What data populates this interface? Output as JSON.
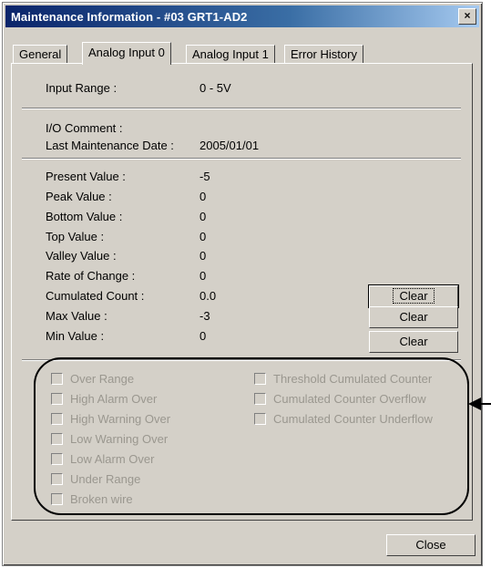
{
  "window": {
    "title": "Maintenance Information - #03 GRT1-AD2",
    "close_glyph": "×"
  },
  "tabs": [
    {
      "label": "General",
      "active": false
    },
    {
      "label": "Analog Input 0",
      "active": true
    },
    {
      "label": "Analog Input 1",
      "active": false
    },
    {
      "label": "Error History",
      "active": false
    }
  ],
  "fields": {
    "input_range": {
      "label": "Input Range :",
      "value": "0 - 5V"
    },
    "io_comment": {
      "label": "I/O Comment :",
      "value": ""
    },
    "last_maintenance_date": {
      "label": "Last Maintenance Date :",
      "value": "2005/01/01"
    },
    "present_value": {
      "label": "Present Value :",
      "value": "-5"
    },
    "peak_value": {
      "label": "Peak Value :",
      "value": "0"
    },
    "bottom_value": {
      "label": "Bottom Value :",
      "value": "0"
    },
    "top_value": {
      "label": "Top Value :",
      "value": "0"
    },
    "valley_value": {
      "label": "Valley Value :",
      "value": "0"
    },
    "rate_of_change": {
      "label": "Rate of Change :",
      "value": "0"
    },
    "cumulated_count": {
      "label": "Cumulated Count :",
      "value": "0.0"
    },
    "max_value": {
      "label": "Max Value :",
      "value": "-3"
    },
    "min_value": {
      "label": "Min Value :",
      "value": "0"
    }
  },
  "buttons": {
    "clear_cumulated": "Clear",
    "clear_max": "Clear",
    "clear_min": "Clear",
    "close": "Close"
  },
  "status_flags": {
    "left": [
      "Over Range",
      "High Alarm Over",
      "High Warning Over",
      "Low Warning Over",
      "Low Alarm Over",
      "Under Range",
      "Broken wire"
    ],
    "right": [
      "Threshold Cumulated Counter",
      "Cumulated Counter Overflow",
      "Cumulated Counter Underflow"
    ]
  },
  "icons": {
    "close": "close-icon",
    "callout": "arrow-left-icon"
  },
  "colors": {
    "title_start": "#0a246a",
    "title_end": "#a6caf0",
    "face": "#d4d0c8",
    "disabled_text": "#9a978f"
  }
}
